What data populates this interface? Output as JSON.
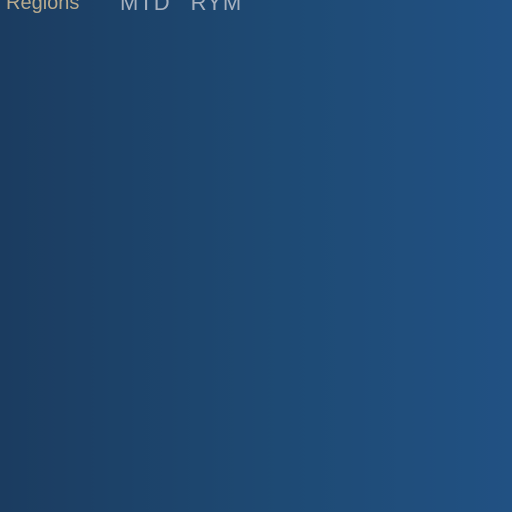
{
  "header": {
    "regions_label": "l Regions",
    "period_tabs": [
      {
        "label": "MTD"
      },
      {
        "label": "RYM"
      }
    ]
  },
  "colors": {
    "background_left": "#1b3c60",
    "background_right": "#215183",
    "regions_text": "#b9ab8e",
    "tab_text": "#a7b1bf"
  }
}
